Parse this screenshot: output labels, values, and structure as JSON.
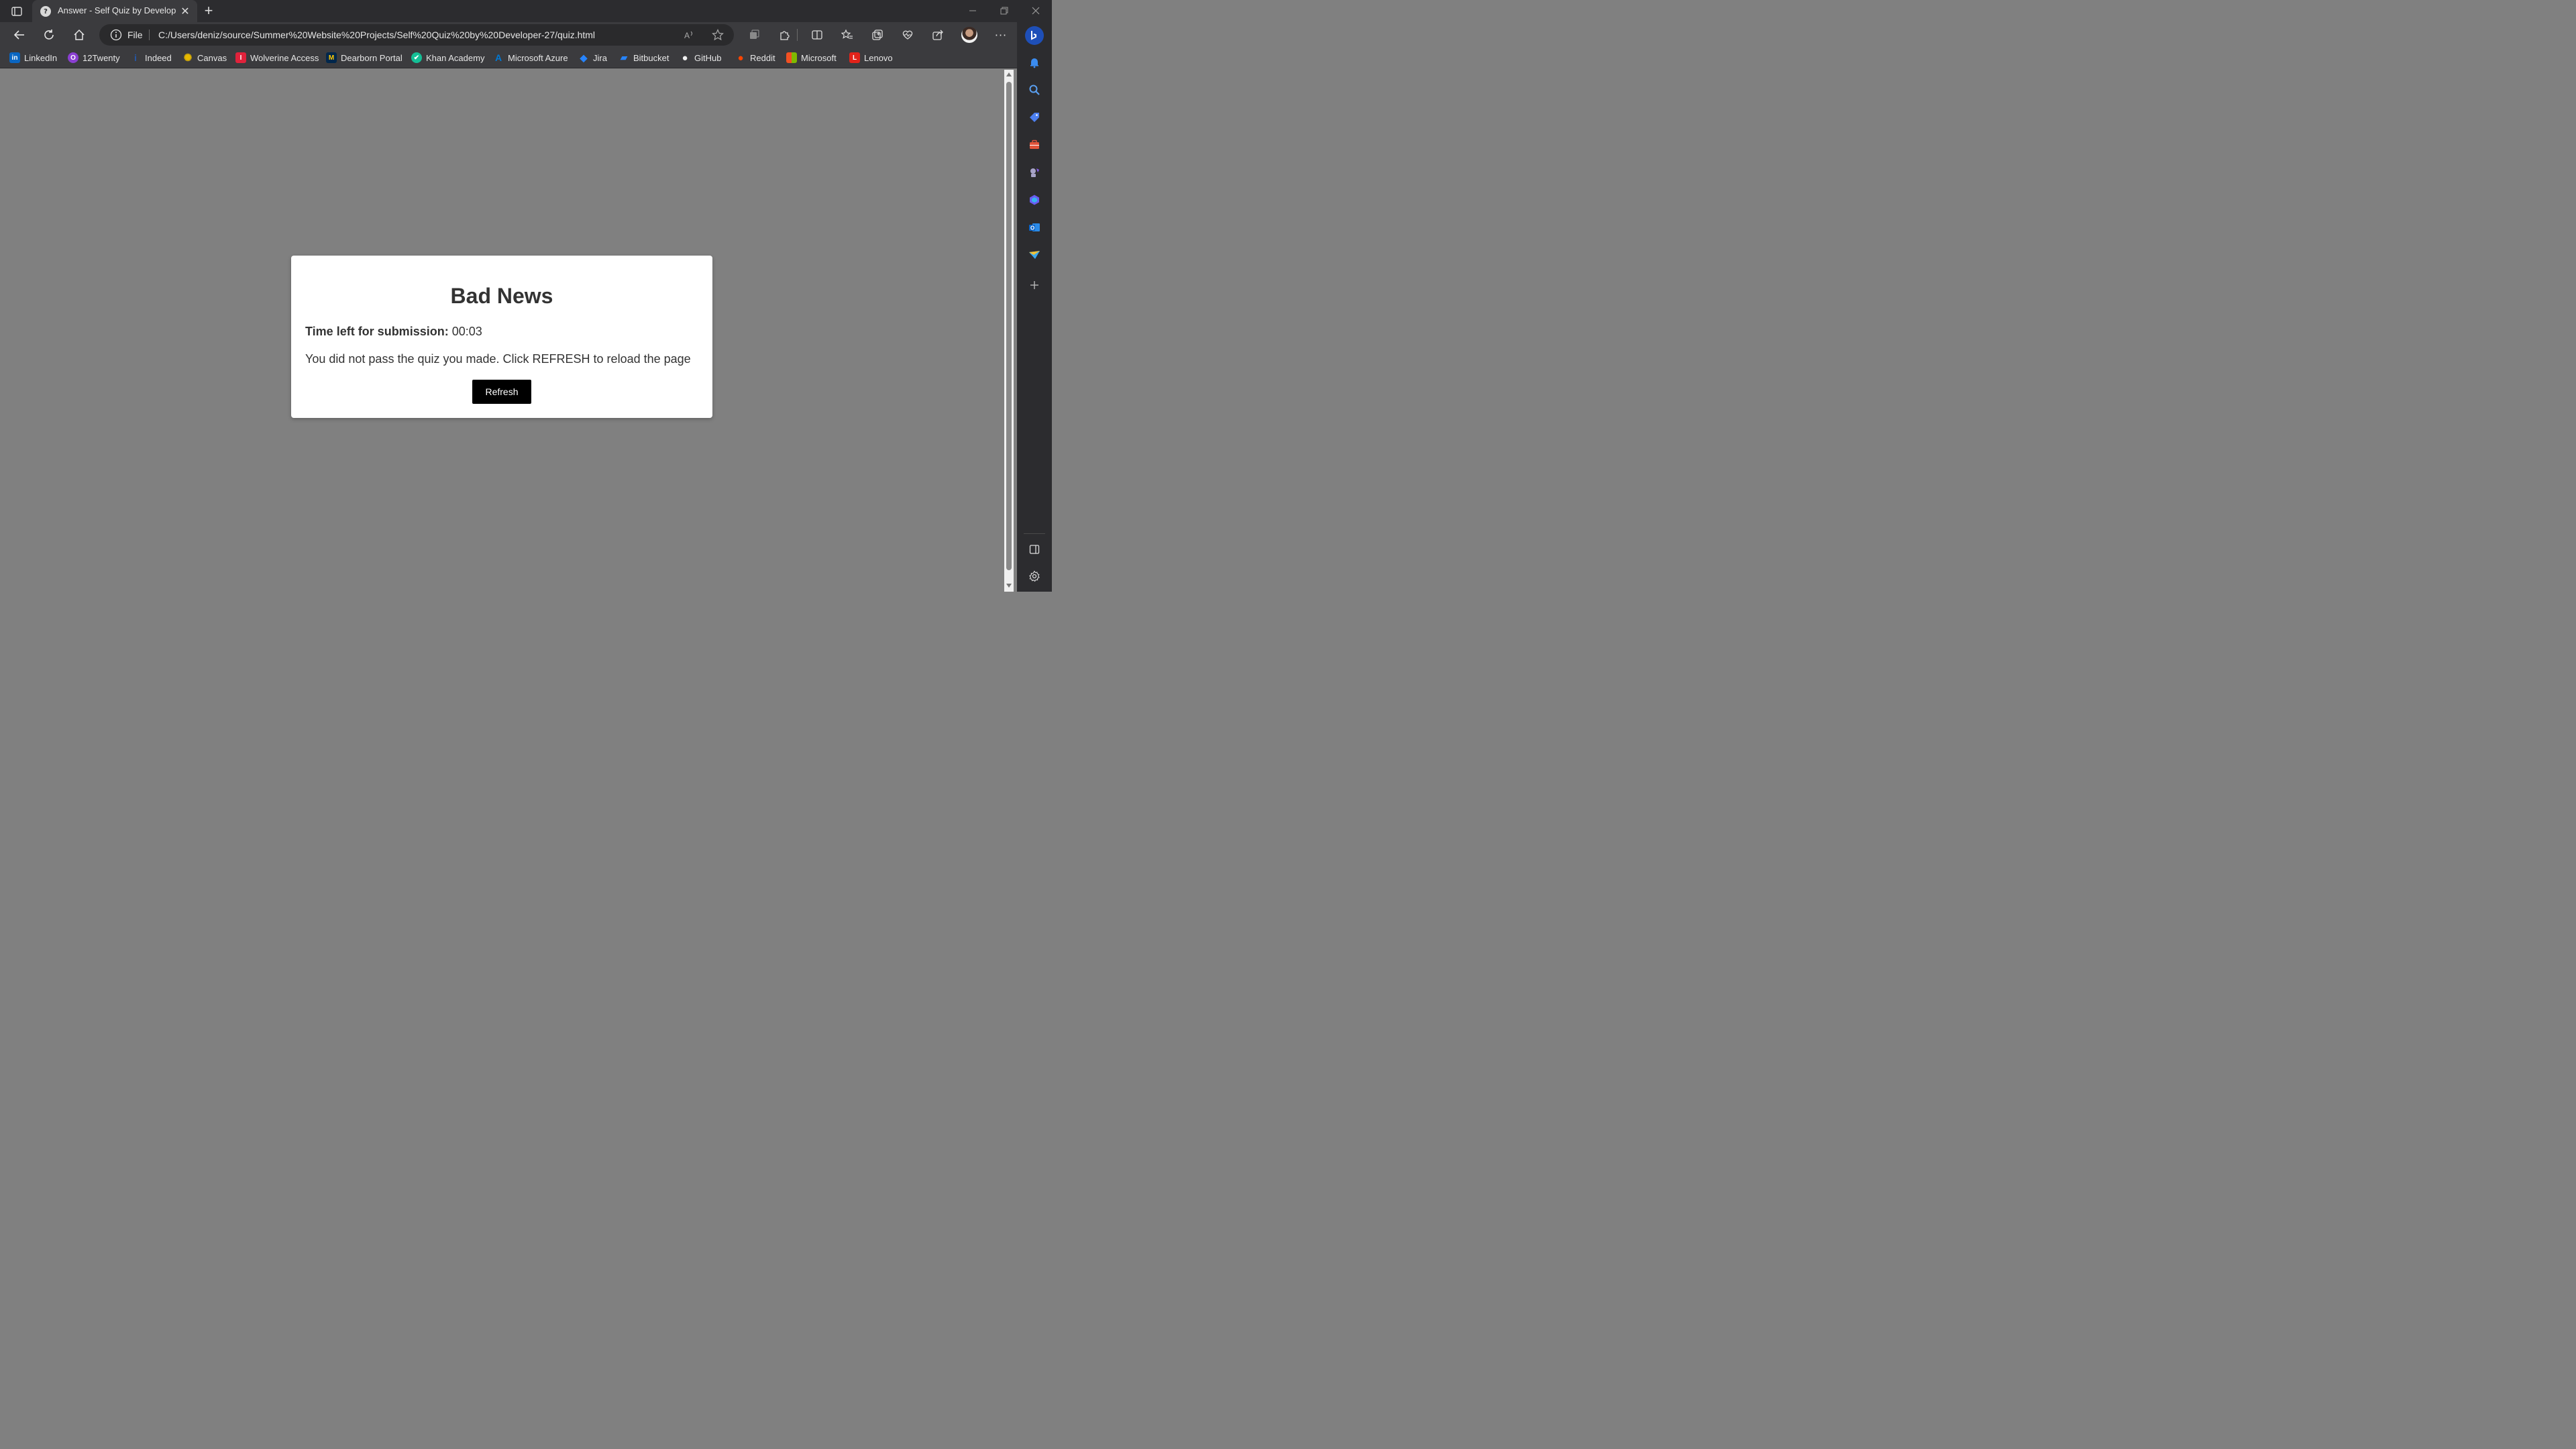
{
  "browser": {
    "tab": {
      "title": "Answer - Self Quiz by Developer",
      "favicon_glyph": "?"
    },
    "new_tab_glyph": "+",
    "close_glyph": "✕",
    "address": {
      "file_label": "File",
      "url": "C:/Users/deniz/source/Summer%20Website%20Projects/Self%20Quiz%20by%20Developer-27/quiz.html"
    },
    "more_glyph": "···"
  },
  "bookmarks": [
    {
      "label": "LinkedIn",
      "icon": "linkedin-icon",
      "glyph": "in",
      "color": "#0a66c2"
    },
    {
      "label": "12Twenty",
      "icon": "12twenty-icon",
      "glyph": "O",
      "color": "#8a3fd1"
    },
    {
      "label": "Indeed",
      "icon": "indeed-icon",
      "glyph": "i",
      "color": "#2557a7"
    },
    {
      "label": "Canvas",
      "icon": "canvas-icon",
      "glyph": "✺",
      "color": "#e6b800"
    },
    {
      "label": "Wolverine Access",
      "icon": "wolverine-access-icon",
      "glyph": "I",
      "color": "#e0223b"
    },
    {
      "label": "Dearborn Portal",
      "icon": "dearborn-portal-icon",
      "glyph": "M",
      "color": "#00274c"
    },
    {
      "label": "Khan Academy",
      "icon": "khan-academy-icon",
      "glyph": "✔",
      "color": "#14bf96"
    },
    {
      "label": "Microsoft Azure",
      "icon": "azure-icon",
      "glyph": "A",
      "color": "#0078d4"
    },
    {
      "label": "Jira",
      "icon": "jira-icon",
      "glyph": "◆",
      "color": "#2684ff"
    },
    {
      "label": "Bitbucket",
      "icon": "bitbucket-icon",
      "glyph": "▰",
      "color": "#2684ff"
    },
    {
      "label": "GitHub",
      "icon": "github-icon",
      "glyph": "●",
      "color": "#f0f0f0"
    },
    {
      "label": "Reddit",
      "icon": "reddit-icon",
      "glyph": "●",
      "color": "#ff4500"
    },
    {
      "label": "Microsoft",
      "icon": "microsoft-icon",
      "glyph": "▦",
      "color": "#f25022"
    },
    {
      "label": "Lenovo",
      "icon": "lenovo-icon",
      "glyph": "L",
      "color": "#e2231a"
    }
  ],
  "page": {
    "title": "Bad News",
    "timer_label": "Time left for submission:",
    "timer_value": "00:03",
    "message": "You did not pass the quiz you made. Click REFRESH to reload the page",
    "refresh_label": "Refresh"
  },
  "colors": {
    "page_background": "#808080",
    "card_background": "#ffffff",
    "button_background": "#000000",
    "browser_chrome": "#3b3b3e"
  }
}
